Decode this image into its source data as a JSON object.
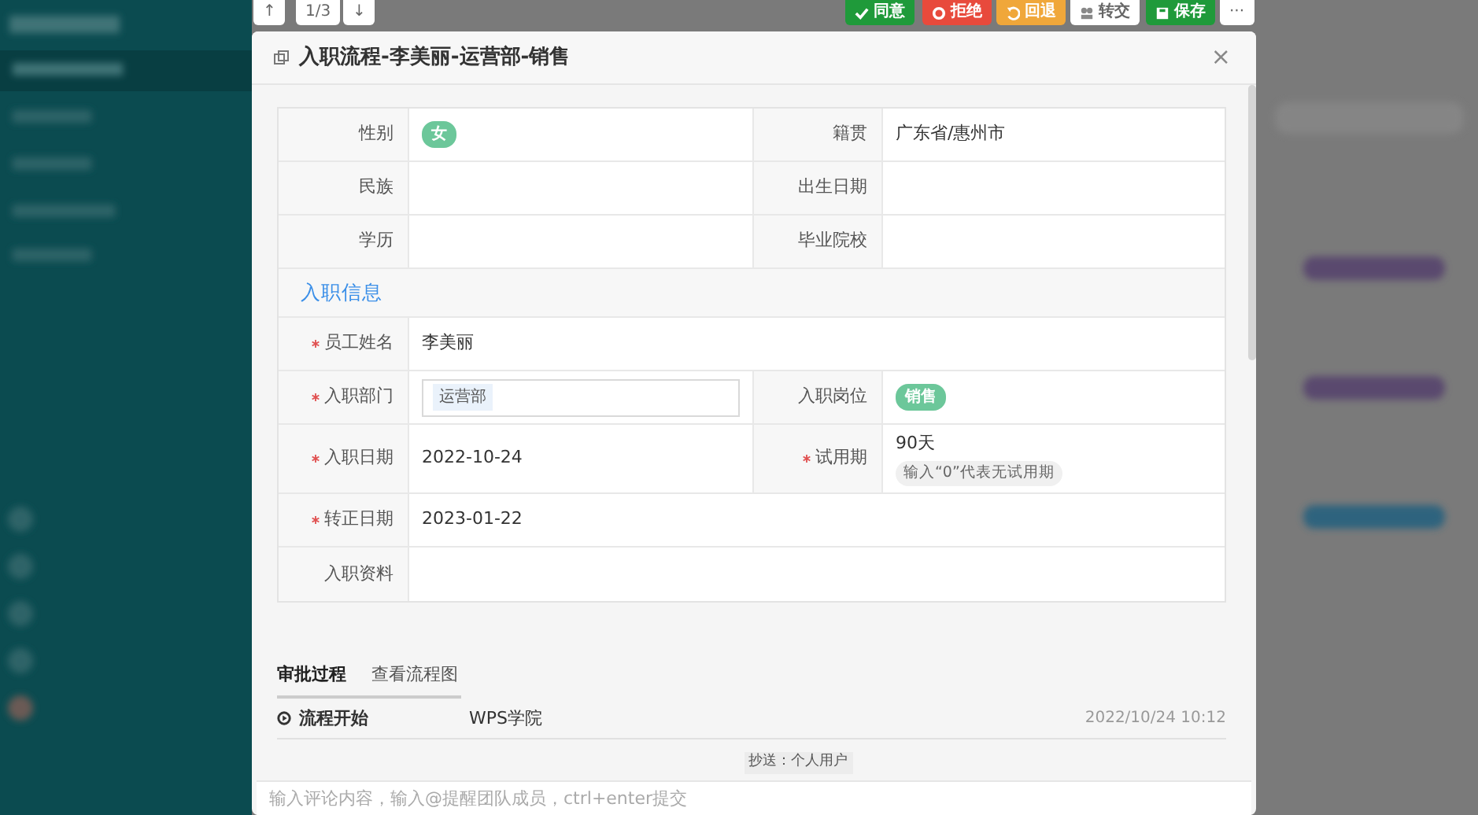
{
  "pager": {
    "up": "↑",
    "position": "1/3",
    "down": "↓"
  },
  "actions": [
    {
      "kind": "approve",
      "label": "同意"
    },
    {
      "kind": "reject",
      "label": "拒绝"
    },
    {
      "kind": "return",
      "label": "回退"
    },
    {
      "kind": "transfer",
      "label": "转交"
    },
    {
      "kind": "save",
      "label": "保存"
    },
    {
      "kind": "more",
      "label": "···"
    }
  ],
  "dialog": {
    "title": "入职流程-李美丽-运营部-销售",
    "close": "×"
  },
  "form_rows": [
    {
      "kind": "fields",
      "cells": [
        {
          "label": "性别",
          "required": false,
          "kind": "tag",
          "value": "女"
        },
        {
          "label": "籍贯",
          "required": false,
          "kind": "text",
          "value": "广东省/惠州市"
        }
      ]
    },
    {
      "kind": "fields",
      "cells": [
        {
          "label": "民族",
          "required": false,
          "kind": "text"
        },
        {
          "label": "出生日期",
          "required": false,
          "kind": "text"
        }
      ]
    },
    {
      "kind": "fields",
      "cells": [
        {
          "label": "学历",
          "required": false,
          "kind": "text"
        },
        {
          "label": "毕业院校",
          "required": false,
          "kind": "text"
        }
      ]
    },
    {
      "kind": "section",
      "title": "入职信息"
    },
    {
      "kind": "fields",
      "cells": [
        {
          "label": "员工姓名",
          "required": true,
          "kind": "text",
          "value": "李美丽"
        }
      ]
    },
    {
      "kind": "fields",
      "cells": [
        {
          "label": "入职部门",
          "required": true,
          "kind": "select",
          "value": "运营部"
        },
        {
          "label": "入职岗位",
          "required": false,
          "kind": "tag",
          "value": "销售"
        }
      ]
    },
    {
      "kind": "fields",
      "cells": [
        {
          "label": "入职日期",
          "required": true,
          "kind": "text",
          "value": "2022-10-24"
        },
        {
          "label": "试用期",
          "required": true,
          "kind": "hint",
          "value": "90天",
          "hint": "输入“0”代表无试用期"
        }
      ]
    },
    {
      "kind": "fields",
      "cells": [
        {
          "label": "转正日期",
          "required": true,
          "kind": "text",
          "value": "2023-01-22"
        }
      ]
    },
    {
      "kind": "fields",
      "cells": [
        {
          "label": "入职资料",
          "required": false,
          "kind": "text"
        }
      ]
    }
  ],
  "tabs": [
    {
      "label": "审批过程",
      "selected": true
    },
    {
      "label": "查看流程图",
      "selected": false
    }
  ],
  "approval_steps": [
    {
      "step": "流程开始",
      "person": "WPS学院",
      "time": "2022/10/24 10:12"
    }
  ],
  "cc": "抄送：个人用户",
  "comment": {
    "placeholder": "输入评论内容，输入@提醒团队成员，ctrl+enter提交"
  }
}
